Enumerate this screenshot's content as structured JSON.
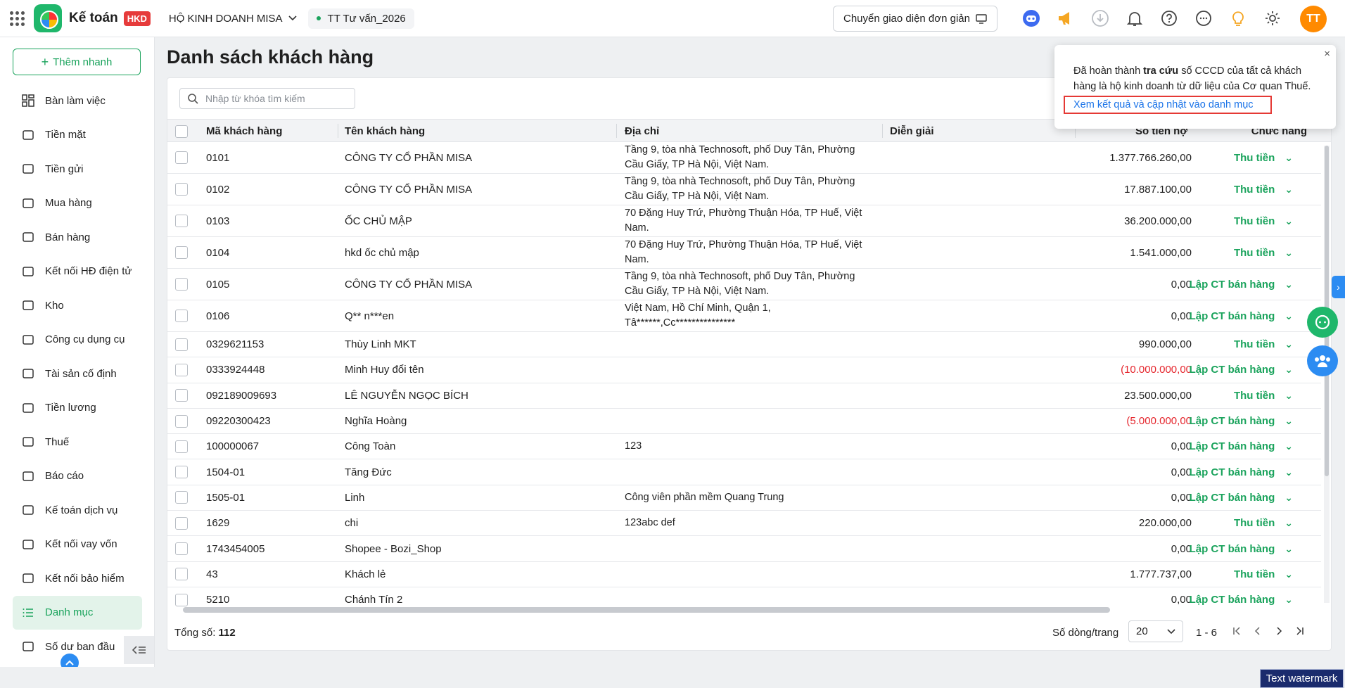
{
  "topbar": {
    "brand": "Kế toán",
    "brand_badge": "HKD",
    "company": "HỘ KINH DOANH MISA",
    "period": "TT Tư vấn_2026",
    "switch_ui_label": "Chuyển giao diện đơn giản",
    "avatar_initials": "TT",
    "icons": [
      "ai-assistant-icon",
      "megaphone-icon",
      "download-icon",
      "bell-icon",
      "help-icon",
      "more-icon",
      "lightbulb-icon",
      "gear-icon"
    ]
  },
  "sidebar": {
    "add_button": "Thêm nhanh",
    "items": [
      {
        "label": "Bàn làm việc",
        "icon": "dashboard-icon"
      },
      {
        "label": "Tiền mặt",
        "icon": "wallet-icon"
      },
      {
        "label": "Tiền gửi",
        "icon": "card-icon"
      },
      {
        "label": "Mua hàng",
        "icon": "cart-icon"
      },
      {
        "label": "Bán hàng",
        "icon": "tag-icon"
      },
      {
        "label": "Kết nối HĐ điện tử",
        "icon": "invoice-icon"
      },
      {
        "label": "Kho",
        "icon": "box-icon"
      },
      {
        "label": "Công cụ dụng cụ",
        "icon": "tool-icon"
      },
      {
        "label": "Tài sản cố định",
        "icon": "car-icon"
      },
      {
        "label": "Tiền lương",
        "icon": "salary-icon"
      },
      {
        "label": "Thuế",
        "icon": "tax-icon"
      },
      {
        "label": "Báo cáo",
        "icon": "chart-icon"
      },
      {
        "label": "Kế toán dịch vụ",
        "icon": "briefcase-icon"
      },
      {
        "label": "Kết nối vay vốn",
        "icon": "loan-icon"
      },
      {
        "label": "Kết nối bảo hiểm",
        "icon": "shield-icon"
      },
      {
        "label": "Danh mục",
        "icon": "list-icon",
        "active": true
      },
      {
        "label": "Số dư ban đầu",
        "icon": "database-icon"
      }
    ]
  },
  "page": {
    "title": "Danh sách khách hàng",
    "search_placeholder": "Nhập từ khóa tìm kiếm"
  },
  "table": {
    "columns": [
      "Mã khách hàng",
      "Tên khách hàng",
      "Địa chỉ",
      "Diễn giải",
      "Số tiền nợ",
      "Chức năng"
    ],
    "rows": [
      {
        "code": "0101",
        "name": "CÔNG TY CỔ PHẦN MISA",
        "address": "Tầng 9, tòa nhà Technosoft, phố Duy Tân, Phường Cầu Giấy, TP Hà Nội, Việt Nam.",
        "note": "",
        "amount": "1.377.766.260,00",
        "negative": false,
        "action": "Thu tiền",
        "tall": true
      },
      {
        "code": "0102",
        "name": "CÔNG TY CỔ PHẦN MISA",
        "address": "Tầng 9, tòa nhà Technosoft, phố Duy Tân, Phường Cầu Giấy, TP Hà Nội, Việt Nam.",
        "note": "",
        "amount": "17.887.100,00",
        "negative": false,
        "action": "Thu tiền",
        "tall": true
      },
      {
        "code": "0103",
        "name": "ỐC CHỦ MẬP",
        "address": "70 Đặng Huy Trứ, Phường Thuận Hóa, TP Huế, Việt Nam.",
        "note": "",
        "amount": "36.200.000,00",
        "negative": false,
        "action": "Thu tiền",
        "tall": true
      },
      {
        "code": "0104",
        "name": "hkd ốc chủ mập",
        "address": "70 Đặng Huy Trứ, Phường Thuận Hóa, TP Huế, Việt Nam.",
        "note": "",
        "amount": "1.541.000,00",
        "negative": false,
        "action": "Thu tiền",
        "tall": true
      },
      {
        "code": "0105",
        "name": "CÔNG TY CỔ PHẦN MISA",
        "address": "Tầng 9, tòa nhà Technosoft, phố Duy Tân, Phường Cầu Giấy, TP Hà Nội, Việt Nam.",
        "note": "",
        "amount": "0,00",
        "negative": false,
        "action": "Lập CT bán hàng",
        "tall": true
      },
      {
        "code": "0106",
        "name": "Q** n***en",
        "address": "Việt Nam, Hồ Chí Minh, Quận 1, Tâ******,Cc***************",
        "note": "",
        "amount": "0,00",
        "negative": false,
        "action": "Lập CT bán hàng",
        "tall": true
      },
      {
        "code": "0329621153",
        "name": "Thùy Linh MKT",
        "address": "",
        "note": "",
        "amount": "990.000,00",
        "negative": false,
        "action": "Thu tiền",
        "tall": false
      },
      {
        "code": "0333924448",
        "name": "Minh Huy đổi tên",
        "address": "",
        "note": "",
        "amount": "(10.000.000,00",
        "negative": true,
        "action": "Lập CT bán hàng",
        "tall": false
      },
      {
        "code": "092189009693",
        "name": "LÊ NGUYỄN NGỌC BÍCH",
        "address": "",
        "note": "",
        "amount": "23.500.000,00",
        "negative": false,
        "action": "Thu tiền",
        "tall": false
      },
      {
        "code": "09220300423",
        "name": "Nghĩa Hoàng",
        "address": "",
        "note": "",
        "amount": "(5.000.000,00",
        "negative": true,
        "action": "Lập CT bán hàng",
        "tall": false
      },
      {
        "code": "100000067",
        "name": "Công Toàn",
        "address": "123",
        "note": "",
        "amount": "0,00",
        "negative": false,
        "action": "Lập CT bán hàng",
        "tall": false
      },
      {
        "code": "1504-01",
        "name": "Tăng Đức",
        "address": "",
        "note": "",
        "amount": "0,00",
        "negative": false,
        "action": "Lập CT bán hàng",
        "tall": false
      },
      {
        "code": "1505-01",
        "name": "Linh",
        "address": "Công viên phần mềm Quang Trung",
        "note": "",
        "amount": "0,00",
        "negative": false,
        "action": "Lập CT bán hàng",
        "tall": false
      },
      {
        "code": "1629",
        "name": "chi",
        "address": "123abc def",
        "note": "",
        "amount": "220.000,00",
        "negative": false,
        "action": "Thu tiền",
        "tall": false
      },
      {
        "code": "1743454005",
        "name": "Shopee - Bozi_Shop",
        "address": "",
        "note": "",
        "amount": "0,00",
        "negative": false,
        "action": "Lập CT bán hàng",
        "tall": false
      },
      {
        "code": "43",
        "name": "Khách lẻ",
        "address": "",
        "note": "",
        "amount": "1.777.737,00",
        "negative": false,
        "action": "Thu tiền",
        "tall": false
      },
      {
        "code": "5210",
        "name": "Chánh Tín 2",
        "address": "",
        "note": "",
        "amount": "0,00",
        "negative": false,
        "action": "Lập CT bán hàng",
        "tall": false
      }
    ]
  },
  "footer": {
    "total_label": "Tổng số:",
    "total_value": "112",
    "per_page_label": "Số dòng/trang",
    "per_page_value": "20",
    "range": "1 - 6"
  },
  "popup": {
    "text_before": "Đã hoàn thành ",
    "text_bold": "tra cứu",
    "text_after": " số CCCD của tất cả khách hàng là hộ kinh doanh từ dữ liệu của Cơ quan Thuế.",
    "link": "Xem kết quả và cập nhật vào danh mục",
    "close": "×"
  },
  "watermark": "Text watermark",
  "colors": {
    "accent": "#1aa35c",
    "negative": "#e5262d",
    "link": "#1a73e8",
    "avatar": "#ff8a00"
  }
}
